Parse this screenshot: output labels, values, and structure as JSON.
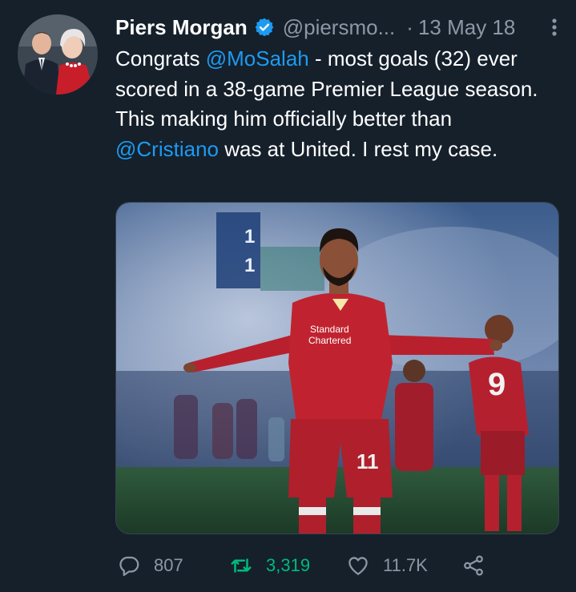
{
  "author": {
    "name": "Piers Morgan",
    "handle": "@piersmo...",
    "separator": "·",
    "date": "13 May 18"
  },
  "tweet": {
    "text_before_mention1": "Congrats ",
    "mention1": "@MoSalah",
    "text_middle": " - most goals (32) ever scored in a 38-game Premier League season. This making him officially better than ",
    "mention2": "@Cristiano",
    "text_after": " was at United. I rest my case."
  },
  "media": {
    "sponsor_line1": "Standard",
    "sponsor_line2": "Chartered",
    "shirt_number_main": "11",
    "shirt_number_right": "9",
    "scoreboard": [
      "1",
      "1"
    ]
  },
  "actions": {
    "reply_count": "807",
    "retweet_count": "3,319",
    "like_count": "11.7K"
  },
  "colors": {
    "background": "#15202b",
    "accent": "#1d9bf0",
    "retweet_active": "#00ba7c",
    "muted": "#8b98a5"
  }
}
